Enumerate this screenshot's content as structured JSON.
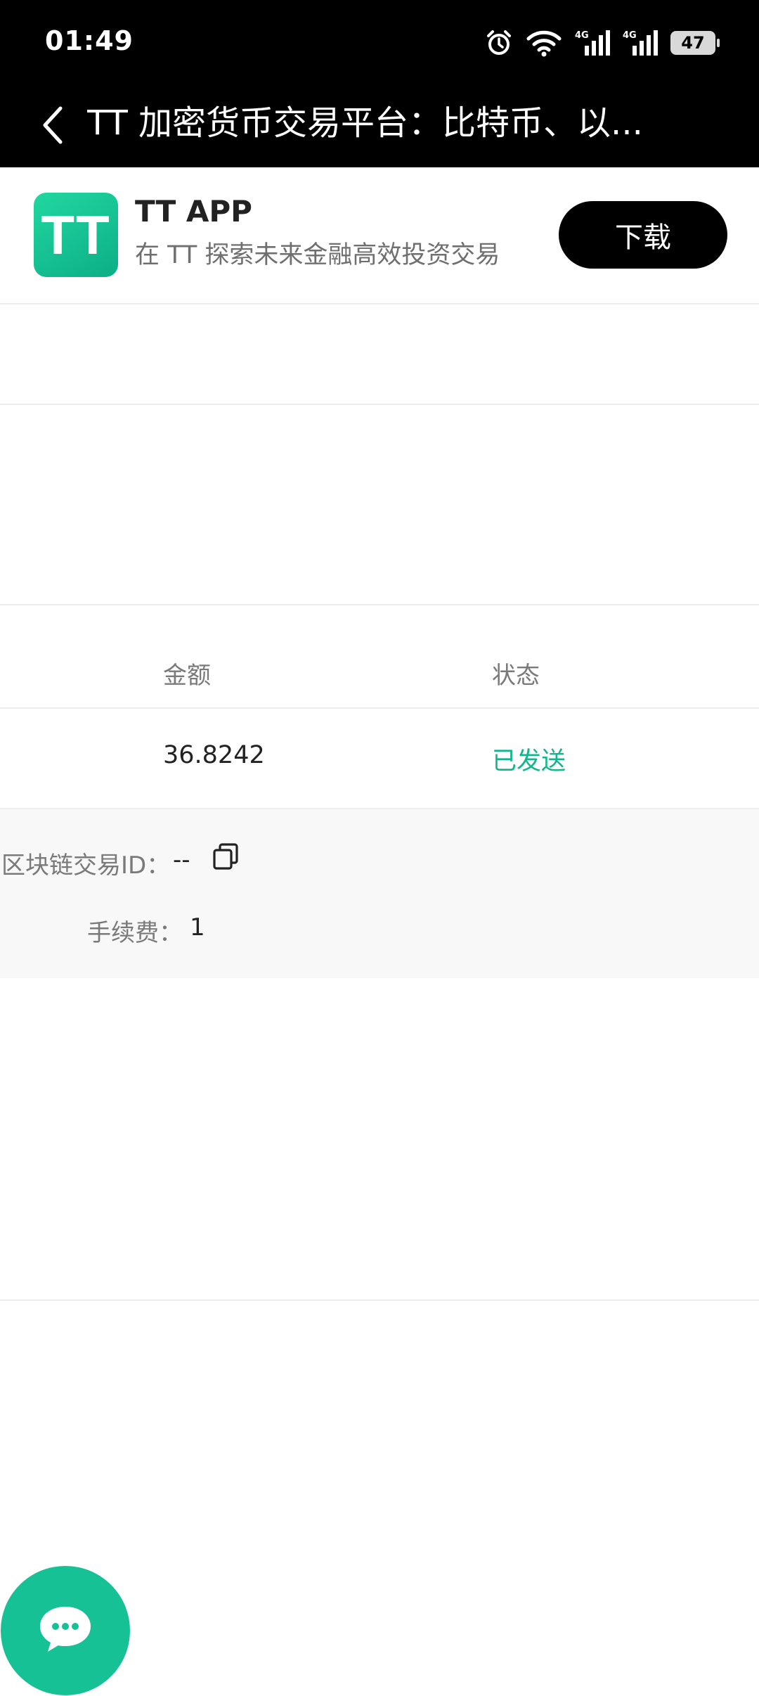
{
  "status_bar": {
    "time": "01:49",
    "battery": "47",
    "icons": [
      "alarm-icon",
      "wifi-icon",
      "signal-4g-icon",
      "signal-4g-icon",
      "battery-icon"
    ]
  },
  "title_bar": {
    "title": "TT 加密货币交易平台：比特币、以...",
    "back_icon": "back-arrow-icon"
  },
  "app_banner": {
    "logo_text": "TT",
    "app_name": "TT APP",
    "description": "在 TT 探索未来金融高效投资交易",
    "download_label": "下载"
  },
  "table": {
    "columns": [
      "金额",
      "状态"
    ],
    "rows": [
      {
        "amount": "36.8242",
        "status": "已发送"
      }
    ]
  },
  "details": {
    "tx_id_label": "区块链交易ID：",
    "tx_id_value": "--",
    "fee_label": "手续费：",
    "fee_value": "1",
    "copy_icon": "copy-icon"
  },
  "chat_fab": {
    "icon": "chat-bubble-icon"
  },
  "colors": {
    "accent": "#13b58c",
    "logo_gradient_start": "#21d7a0",
    "logo_gradient_end": "#0cae86",
    "header_bg": "#000000",
    "details_bg": "#f8f8f8"
  }
}
